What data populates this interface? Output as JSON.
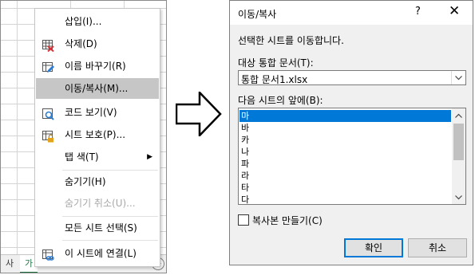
{
  "sheet": {
    "tabs": [
      "사",
      "가"
    ],
    "add_tab_icon": "plus-circle-icon"
  },
  "context_menu": {
    "items": [
      {
        "label": "삽입(I)...",
        "icon": "",
        "disabled": false,
        "highlighted": false
      },
      {
        "label": "삭제(D)",
        "icon": "delete-sheet-icon",
        "disabled": false,
        "highlighted": false
      },
      {
        "label": "이름 바꾸기(R)",
        "icon": "rename-icon",
        "disabled": false,
        "highlighted": false
      },
      {
        "label": "이동/복사(M)...",
        "icon": "",
        "disabled": false,
        "highlighted": true
      },
      {
        "label": "코드 보기(V)",
        "icon": "view-code-icon",
        "disabled": false,
        "highlighted": false
      },
      {
        "label": "시트 보호(P)...",
        "icon": "protect-sheet-icon",
        "disabled": false,
        "highlighted": false
      },
      {
        "label": "탭 색(T)",
        "icon": "",
        "disabled": false,
        "highlighted": false,
        "submenu_arrow": "▶"
      },
      {
        "label": "숨기기(H)",
        "icon": "",
        "disabled": false,
        "highlighted": false
      },
      {
        "label": "숨기기 취소(U)...",
        "icon": "",
        "disabled": true,
        "highlighted": false
      },
      {
        "label": "모든 시트 선택(S)",
        "icon": "",
        "disabled": false,
        "highlighted": false
      },
      {
        "label": "이 시트에 연결(L)",
        "icon": "link-sheet-icon",
        "disabled": false,
        "highlighted": false
      }
    ],
    "highlight_color": "#c6c6c6"
  },
  "dialog": {
    "title": "이동/복사",
    "help": "?",
    "close": "✕",
    "description": "선택한 시트를 이동합니다.",
    "target_book_label": "대상 통합 문서(T):",
    "target_book_value": "통합 문서1.xlsx",
    "before_sheet_label": "다음 시트의 앞에(B):",
    "sheets": [
      "마",
      "바",
      "카",
      "나",
      "파",
      "라",
      "타",
      "다"
    ],
    "selected_sheet": "마",
    "create_copy_label": "복사본 만들기(C)",
    "create_copy_checked": false,
    "ok_label": "확인",
    "cancel_label": "취소",
    "accent_color": "#0078d7"
  }
}
